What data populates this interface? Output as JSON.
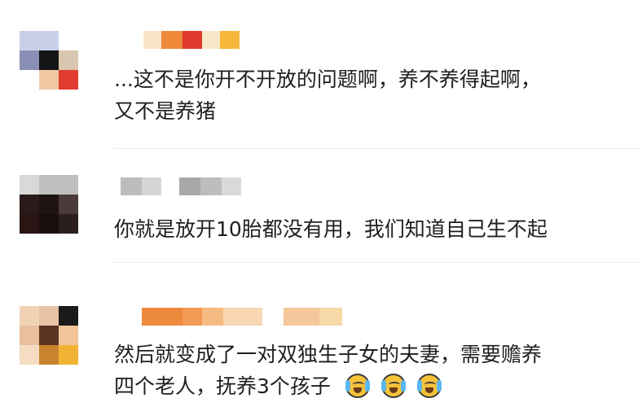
{
  "comments": [
    {
      "avatar_colors": [
        "#c9d1e8",
        "#c9d1e8",
        "#ffffff",
        "#8a8fb6",
        "#151515",
        "#d8c6b0",
        "#ffffff",
        "#f2c7a4",
        "#e23b2f"
      ],
      "name_colors": [
        "#fbe3c8",
        "#f08a3a",
        "#e0382a",
        "#f7e7c8",
        "#f5b83a"
      ],
      "lines": [
        "...这不是你开不开放的问题啊，养不养得起啊，",
        "又不是养猪"
      ]
    },
    {
      "avatar_colors": [
        "#d9d9d9",
        "#bfbfbf",
        "#bfbfbf",
        "#2a1a1a",
        "#1e1414",
        "#4a3a3a",
        "#2a1414",
        "#1a0f0f",
        "#2b1e1e"
      ],
      "name_colors": [
        "#bdbdbd",
        "#d6d6d6",
        "#a8a8a8",
        "#bdbdbd",
        "#d9d9d9"
      ],
      "lines": [
        "你就是放开10胎都没有用，我们知道自己生不起"
      ]
    },
    {
      "avatar_colors": [
        "#f1d3b4",
        "#e7c3a6",
        "#1a1a1a",
        "#e9c09e",
        "#5a3420",
        "#f2c49a",
        "#f5dcc3",
        "#c9842f",
        "#f2b234"
      ],
      "name_colors": [
        "#ee8a3e",
        "#f39a55",
        "#f6bb83",
        "#f8d7b2",
        "#f5c79a",
        "#f8d9a8"
      ],
      "lines": [
        "然后就变成了一对双独生子女的夫妻，需要赡养",
        "四个老人，抚养3个孩子"
      ],
      "emojis": [
        "crying-laughing-emoji",
        "crying-laughing-emoji",
        "crying-laughing-emoji"
      ]
    }
  ]
}
